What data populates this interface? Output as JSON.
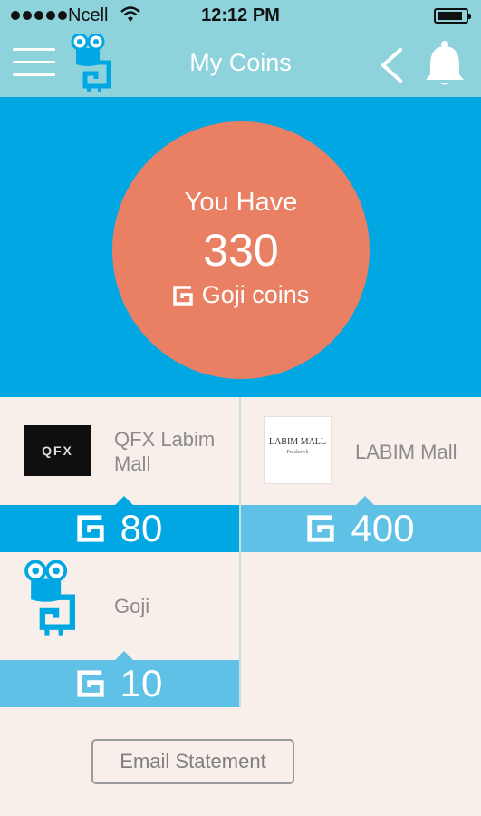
{
  "status_bar": {
    "carrier": "Ncell",
    "time": "12:12 PM",
    "battery_level": 0.85
  },
  "nav": {
    "title": "My Coins",
    "menu_icon": "hamburger-icon",
    "logo": "goji-mascot-logo",
    "back_icon": "chevron-left-icon",
    "notification_icon": "bell-icon"
  },
  "balance": {
    "prefix": "You Have",
    "amount": "330",
    "unit": "Goji coins",
    "unit_icon": "goji-coin-icon"
  },
  "merchants": [
    {
      "name": "QFX Labim Mall",
      "logo_text": "QFX",
      "coins": "80"
    },
    {
      "name": "LABIM Mall",
      "logo_text": "LABIM MALL",
      "logo_subtext": "Pulchowk",
      "coins": "400"
    },
    {
      "name": "Goji",
      "coins": "10"
    }
  ],
  "actions": {
    "email_statement": "Email Statement"
  },
  "colors": {
    "header": "#8ed3dc",
    "hero": "#00a7e3",
    "circle": "#e98064",
    "bar_active": "#00a7e3",
    "bar_light": "#5fc1e6",
    "background": "#f8efea"
  }
}
